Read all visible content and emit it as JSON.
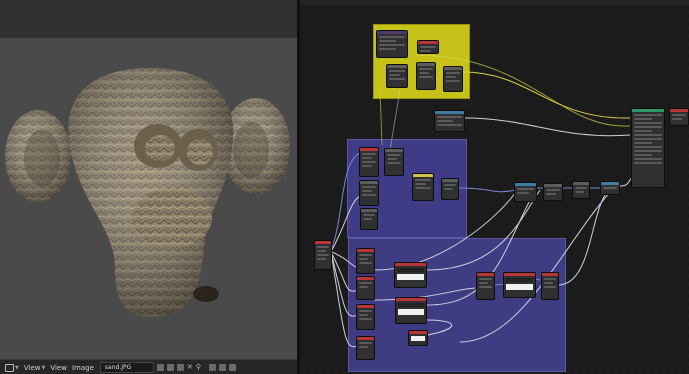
{
  "image_editor": {
    "header": {
      "menus": [
        {
          "label": "View"
        },
        {
          "label": "View"
        },
        {
          "label": "Image"
        }
      ],
      "image_name": "sand.JPG"
    }
  },
  "node_editor": {
    "header": {
      "items": [
        "",
        "",
        ""
      ]
    },
    "frames": [
      {
        "label": ""
      },
      {
        "label": ""
      },
      {
        "label": ""
      }
    ]
  },
  "colors": {
    "frame_yellow": "#c6c21a",
    "frame_blue": "#3f3b86",
    "frame_blue2": "#3e3d84",
    "wire_yellow": "#d8d24a",
    "wire_light": "#cfd2dc",
    "wire_blue": "#7d83d8"
  }
}
